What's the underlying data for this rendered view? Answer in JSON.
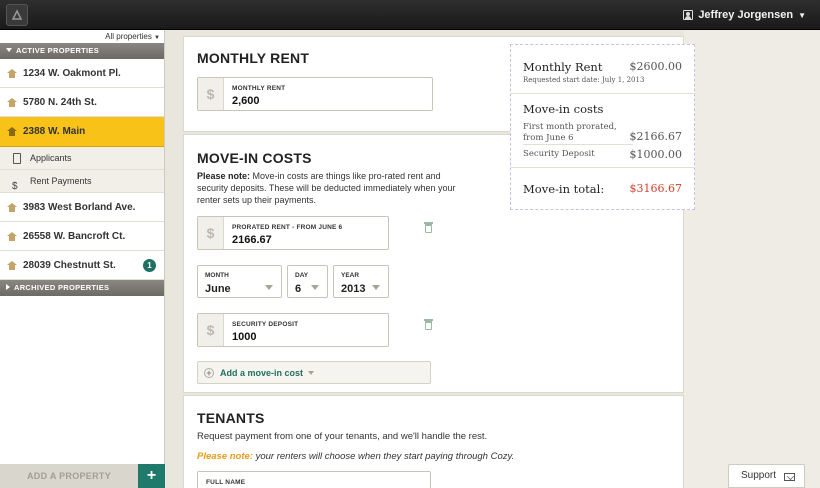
{
  "user": {
    "name": "Jeffrey Jorgensen"
  },
  "sidebar": {
    "filter_label": "All properties",
    "active_header": "Active properties",
    "properties": [
      {
        "label": "1234 W. Oakmont Pl."
      },
      {
        "label": "5780 N. 24th St."
      },
      {
        "label": "2388 W. Main"
      },
      {
        "label": "3983 West Borland Ave."
      },
      {
        "label": "26558 W. Bancroft Ct."
      },
      {
        "label": "28039 Chestnutt St.",
        "badge": "1"
      }
    ],
    "subitems": [
      {
        "label": "Applicants"
      },
      {
        "label": "Rent Payments"
      }
    ],
    "archived_header": "Archived properties",
    "add_property_label": "ADD A PROPERTY",
    "add_property_plus": "+"
  },
  "monthly_rent": {
    "title": "MONTHLY RENT",
    "field_label": "MONTHLY RENT",
    "field_value": "2,600",
    "currency_symbol": "$"
  },
  "move_in": {
    "title": "MOVE-IN COSTS",
    "note_prefix": "Please note:",
    "note_text": " Move-in costs are things like pro-rated rent and security deposits. These will be deducted immediately when your renter sets up their payments.",
    "prorated_label": "PRORATED RENT - FROM JUNE 6",
    "prorated_value": "2166.67",
    "month_label": "MONTH",
    "month_value": "June",
    "day_label": "DAY",
    "day_value": "6",
    "year_label": "YEAR",
    "year_value": "2013",
    "deposit_label": "SECURITY DEPOSIT",
    "deposit_value": "1000",
    "add_cost_label": "Add a move-in cost",
    "currency_symbol": "$"
  },
  "tenants": {
    "title": "TENANTS",
    "intro": "Request payment from one of your tenants, and we'll handle the rest.",
    "note_prefix": "Please note:",
    "note_text": " your renters will choose when they start paying through Cozy.",
    "full_name_label": "FULL NAME"
  },
  "summary": {
    "monthly_rent_label": "Monthly Rent",
    "monthly_rent_amount": "$2600.00",
    "requested_start": "Requested start date: July 1, 2013",
    "move_in_label": "Move-in costs",
    "first_month_label": "First month prorated, from June 6",
    "first_month_amount": "$2166.67",
    "deposit_label": "Security Deposit",
    "deposit_amount": "$1000.00",
    "total_label": "Move-in total:",
    "total_amount": "$3166.67"
  },
  "support": {
    "label": "Support"
  },
  "colors": {
    "accent_yellow": "#f8c218",
    "accent_teal": "#1f6f63",
    "total_red": "#d5402a",
    "note_orange": "#e89b1c"
  }
}
